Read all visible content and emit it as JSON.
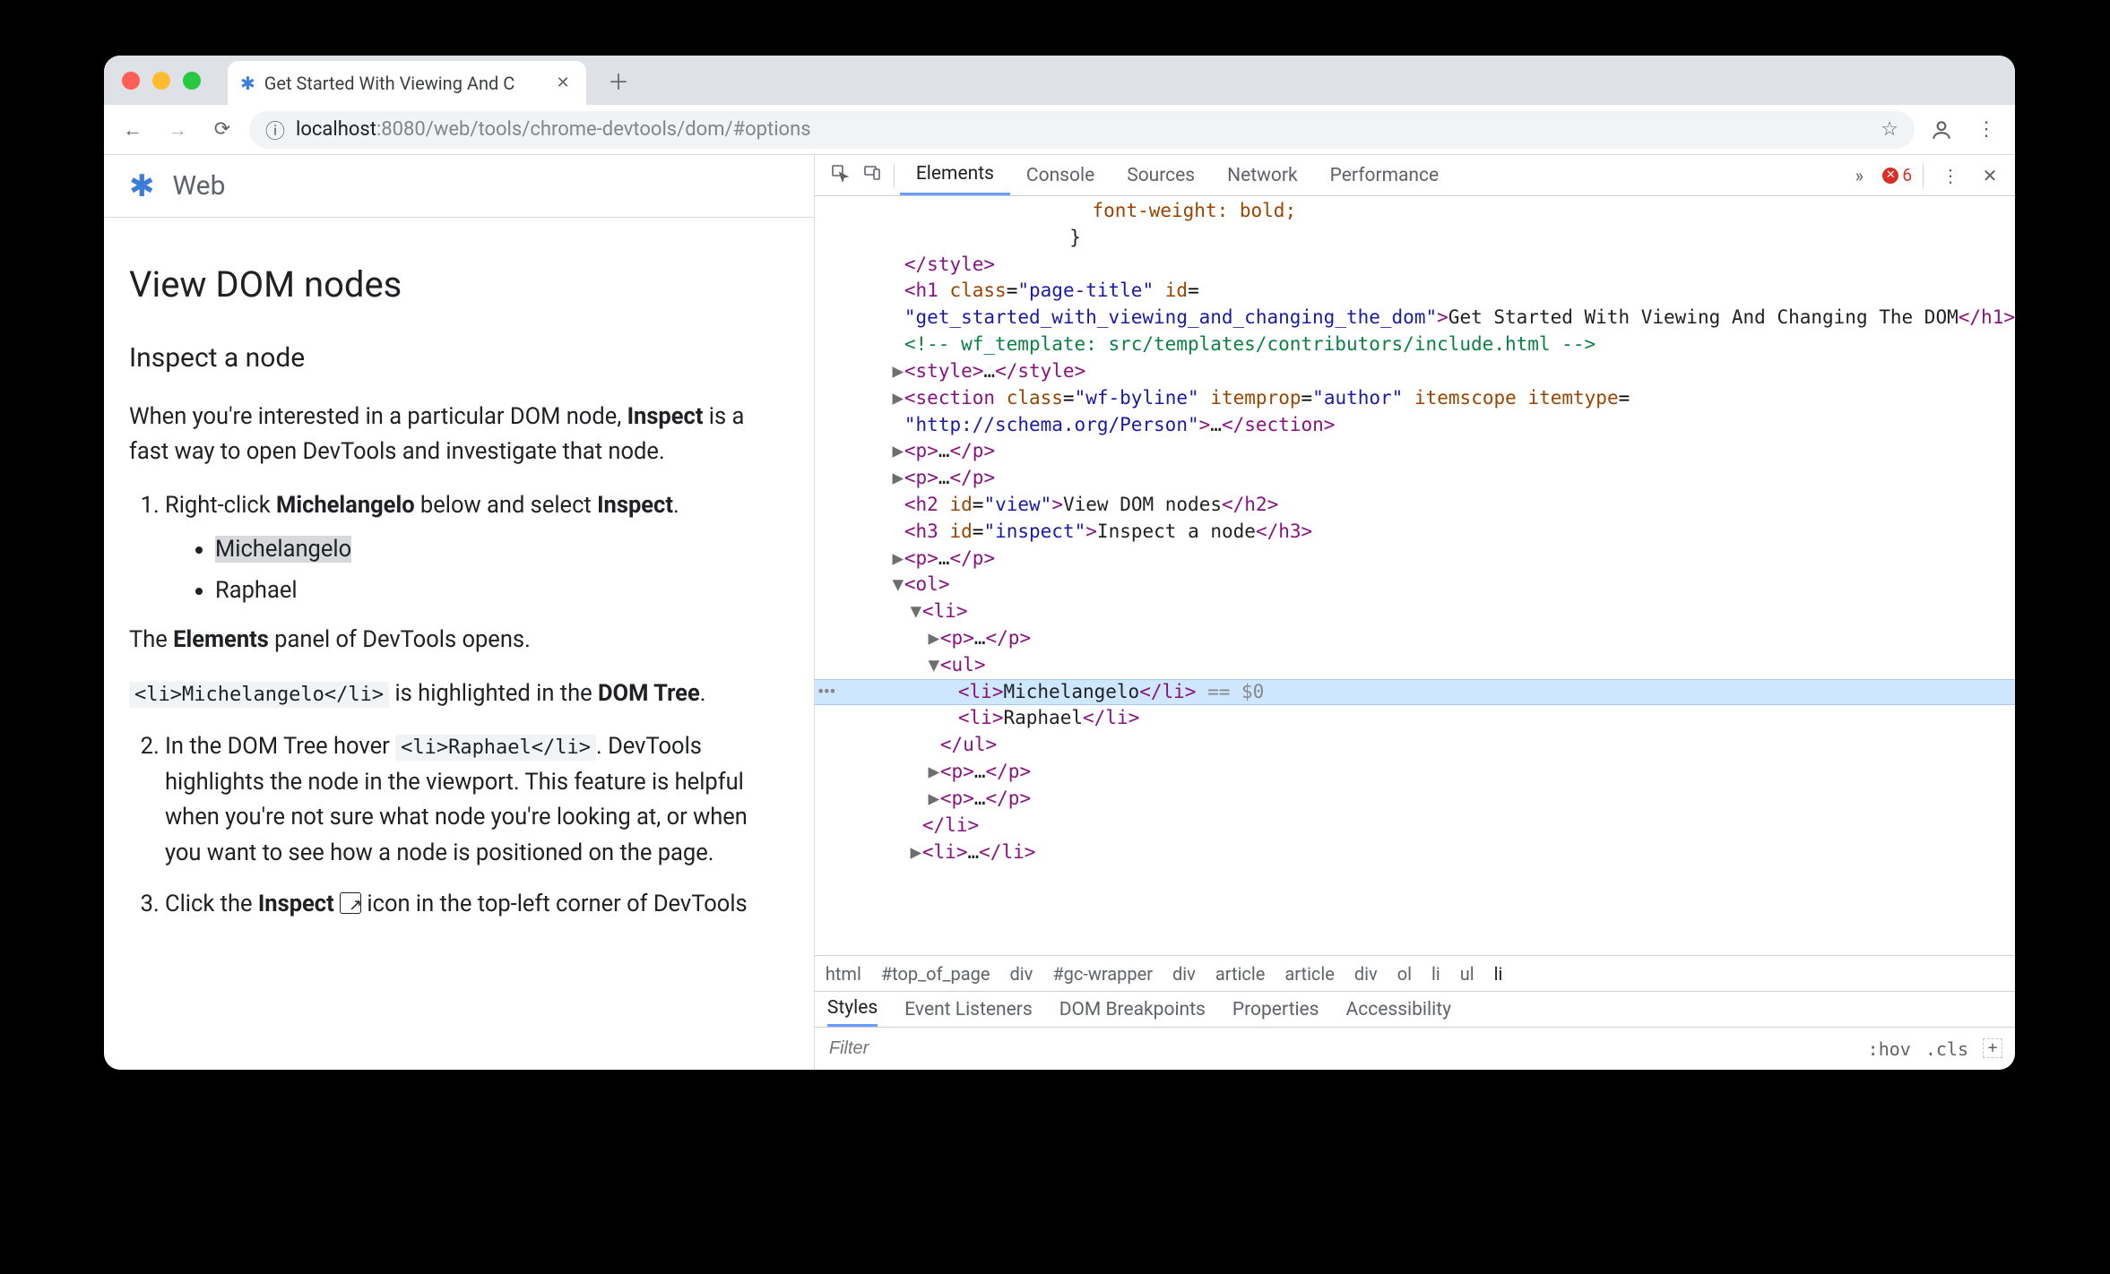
{
  "browser": {
    "tab_title": "Get Started With Viewing And C",
    "url_host": "localhost",
    "url_port": ":8080",
    "url_path": "/web/tools/chrome-devtools/dom/#options"
  },
  "page": {
    "site_title": "Web",
    "h2": "View DOM nodes",
    "h3": "Inspect a node",
    "intro_pre": "When you're interested in a particular DOM node, ",
    "intro_bold": "Inspect",
    "intro_post": " is a fast way to open DevTools and investigate that node.",
    "step1_pre": "Right-click ",
    "step1_bold": "Michelangelo",
    "step1_mid": " below and select ",
    "step1_bold2": "Inspect",
    "step1_post": ".",
    "li1": "Michelangelo",
    "li2": "Raphael",
    "step1b_pre": "The ",
    "step1b_bold": "Elements",
    "step1b_post": " panel of DevTools opens.",
    "step1c_code": "<li>Michelangelo</li>",
    "step1c_mid": " is highlighted in the ",
    "step1c_bold": "DOM Tree",
    "step1c_post": ".",
    "step2_pre": "In the DOM Tree hover ",
    "step2_code": "<li>Raphael</li>",
    "step2_post": ". DevTools highlights the node in the viewport. This feature is helpful when you're not sure what node you're looking at, or when you want to see how a node is positioned on the page.",
    "step3_pre": "Click the ",
    "step3_bold": "Inspect",
    "step3_post": " icon in the top-left corner of DevTools"
  },
  "devtools": {
    "tabs": [
      "Elements",
      "Console",
      "Sources",
      "Network",
      "Performance"
    ],
    "error_count": "6",
    "crumbs": [
      "html",
      "#top_of_page",
      "div",
      "#gc-wrapper",
      "div",
      "article",
      "article",
      "div",
      "ol",
      "li",
      "ul",
      "li"
    ],
    "subtabs": [
      "Styles",
      "Event Listeners",
      "DOM Breakpoints",
      "Properties",
      "Accessibility"
    ],
    "filter_placeholder": "Filter",
    "hov": ":hov",
    "cls": ".cls",
    "src": {
      "l0": "               font-weight: bold;",
      "l1a": "             }",
      "l1b": "           </",
      "l1b_tag": "style",
      "l1b_end": ">",
      "l2a": "           <",
      "l2_tag": "h1",
      "l2_attr1": "class",
      "l2_val1": "page-title",
      "l2_attr2": "id",
      "l3_val": "get_started_with_viewing_and_changing_the_dom",
      "l3_txt": "Get Started With Viewing And Changing The DOM",
      "l3_close": "h1",
      "l4_cmt": "<!-- wf_template: src/templates/contributors/include.html -->",
      "l5_tag": "style",
      "l6_tag": "section",
      "l6_a1": "class",
      "l6_v1": "wf-byline",
      "l6_a2": "itemprop",
      "l6_v2": "author",
      "l6_a3": "itemscope",
      "l6_a4": "itemtype",
      "l6_v4": "http://schema.org/Person",
      "p_tag": "p",
      "h2_tag": "h2",
      "h2_attr": "id",
      "h2_val": "view",
      "h2_txt": "View DOM nodes",
      "h3_tag": "h3",
      "h3_attr": "id",
      "h3_val": "inspect",
      "h3_txt": "Inspect a node",
      "ol_tag": "ol",
      "li_tag": "li",
      "ul_tag": "ul",
      "mich": "Michelangelo",
      "raph": "Raphael",
      "sel_marker": " == $0"
    }
  }
}
